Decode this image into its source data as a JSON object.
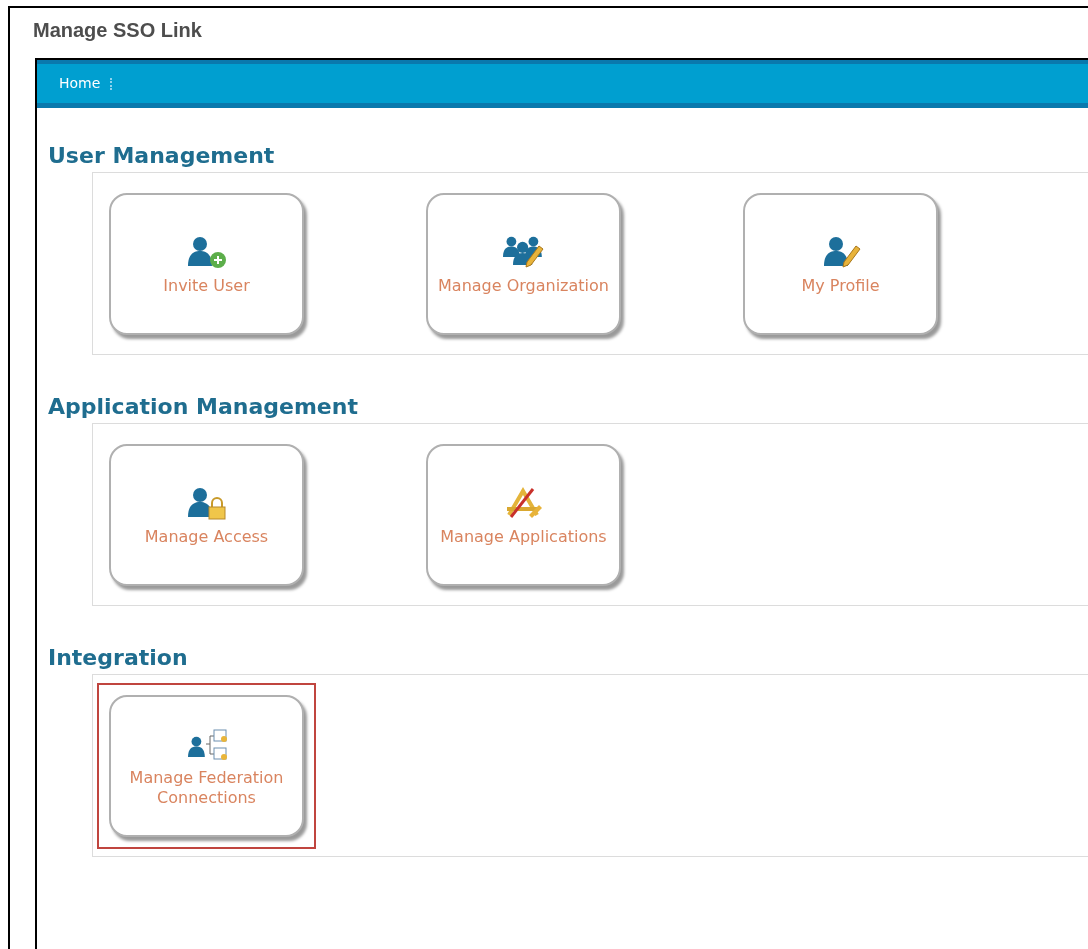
{
  "page_title": "Manage SSO Link",
  "nav": {
    "items": [
      "Home"
    ]
  },
  "sections": [
    {
      "title": "User Management",
      "tiles": [
        {
          "kind": "invite",
          "label": "Invite User",
          "highlighted": false
        },
        {
          "kind": "organization",
          "label": "Manage Organization",
          "highlighted": false
        },
        {
          "kind": "profile",
          "label": "My Profile",
          "highlighted": false
        }
      ]
    },
    {
      "title": "Application Management",
      "tiles": [
        {
          "kind": "access",
          "label": "Manage Access",
          "highlighted": false
        },
        {
          "kind": "applications",
          "label": "Manage Applications",
          "highlighted": false
        }
      ]
    },
    {
      "title": "Integration",
      "tiles": [
        {
          "kind": "federation",
          "label": "Manage Federation Connections",
          "highlighted": true
        }
      ]
    }
  ]
}
